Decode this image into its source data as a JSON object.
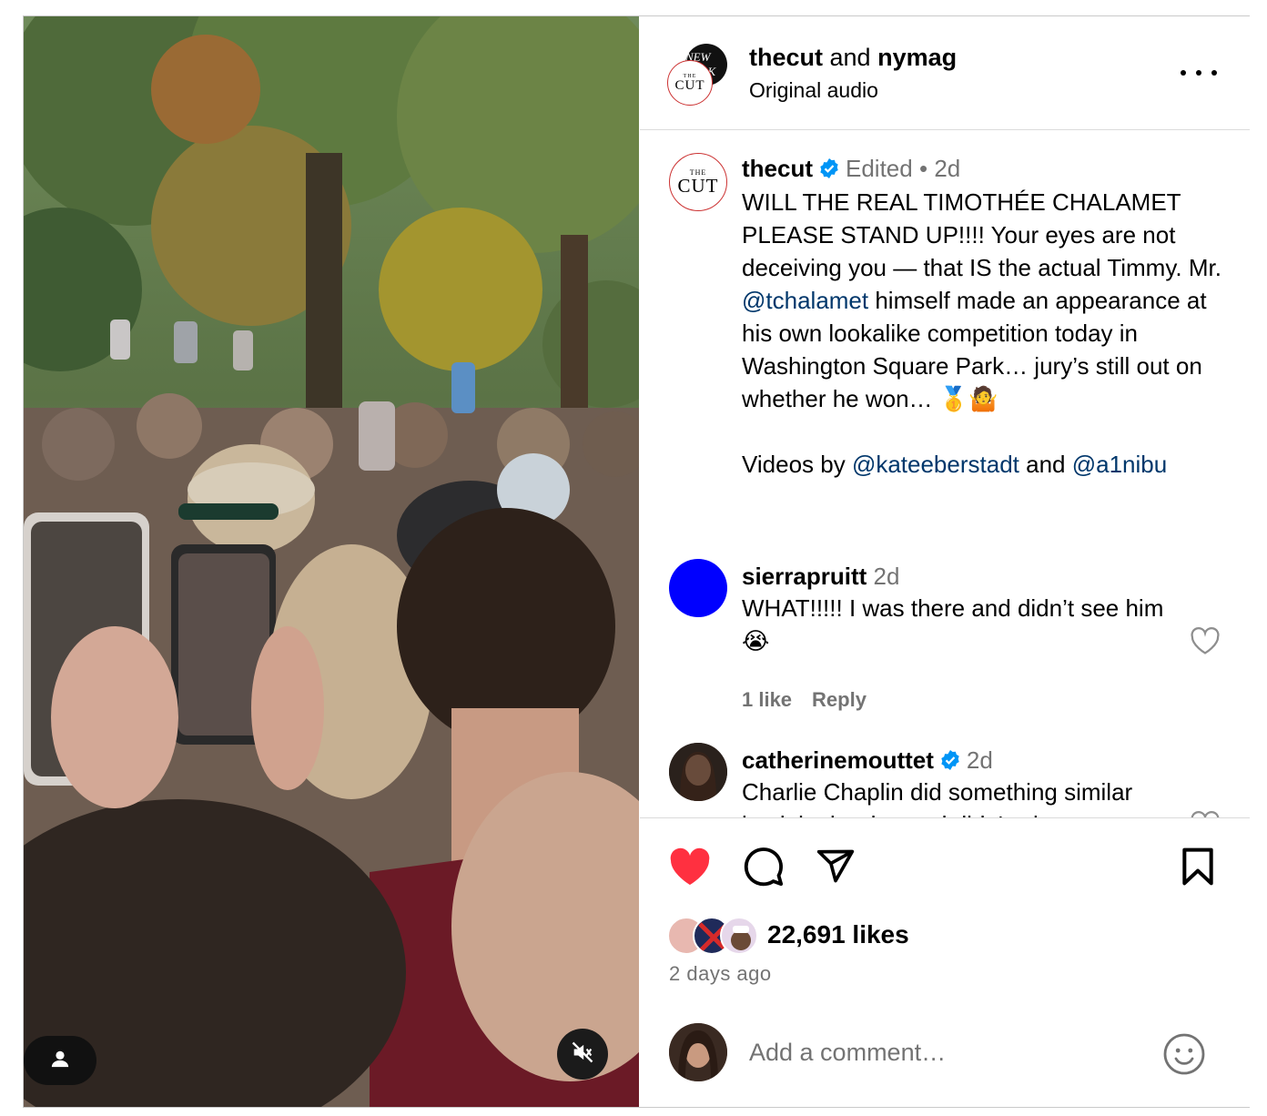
{
  "header": {
    "account_1": "thecut",
    "joiner": "and",
    "account_2": "nymag",
    "audio": "Original audio",
    "avatar_ny_text": "NEW YORK",
    "avatar_cut_the": "THE",
    "avatar_cut_cut": "CUT"
  },
  "caption": {
    "username": "thecut",
    "edited": "Edited",
    "dot": "•",
    "time": "2d",
    "lines": [
      "WILL THE REAL TIMOTHÉE CHALAMET PLEASE STAND UP!!!! Your eyes are not deceiving you — that IS the actual Timmy. Mr. ",
      "@tchalamet",
      " himself made an appearance at his own lookalike competition today in Washington Square Park… jury’s still out on whether he won… 🥇🤷",
      "Videos by ",
      "@kateeberstadt",
      " and ",
      "@a1nibu"
    ]
  },
  "comments": [
    {
      "username": "sierrapruitt",
      "time": "2d",
      "text": "WHAT!!!!! I was there and didn’t see him 😭",
      "likes": "1 like",
      "reply": "Reply"
    },
    {
      "username": "catherinemouttet",
      "time": "2d",
      "text": "Charlie Chaplin did something similar back in the day and didn't win"
    }
  ],
  "actions": {
    "likes": "22,691 likes",
    "time_ago": "2 days ago",
    "heart_color": "#ff3040"
  },
  "add_comment": {
    "placeholder": "Add a comment…"
  },
  "icons": {
    "more": "more-options-icon",
    "like": "heart-filled-icon",
    "comment": "comment-bubble-icon",
    "share": "paper-plane-icon",
    "save": "bookmark-icon",
    "emoji": "emoji-smile-icon",
    "tagged": "user-tag-icon",
    "mute": "speaker-muted-icon",
    "verified": "verified-badge-icon"
  }
}
